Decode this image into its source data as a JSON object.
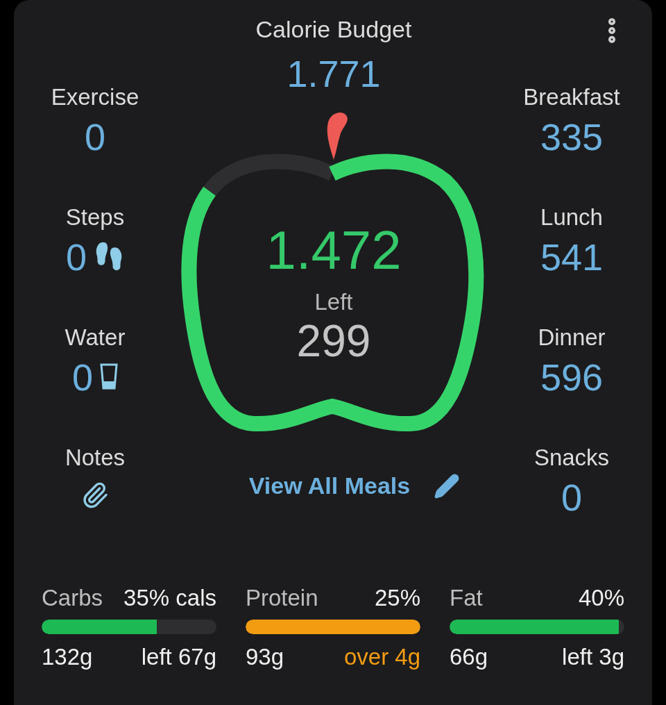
{
  "header": {
    "title": "Calorie Budget",
    "budget": "1.771"
  },
  "left_stats": [
    {
      "kind": "plain",
      "label": "Exercise",
      "value": "0"
    },
    {
      "kind": "steps",
      "label": "Steps",
      "value": "0"
    },
    {
      "kind": "water",
      "label": "Water",
      "value": "0"
    },
    {
      "kind": "notes",
      "label": "Notes"
    }
  ],
  "right_stats": [
    {
      "label": "Breakfast",
      "value": "335"
    },
    {
      "label": "Lunch",
      "value": "541"
    },
    {
      "label": "Dinner",
      "value": "596"
    },
    {
      "label": "Snacks",
      "value": "0"
    }
  ],
  "ring": {
    "consumed": "1.472",
    "caption": "Left",
    "remaining": "299"
  },
  "view_all": {
    "label": "View All Meals"
  },
  "macros": [
    {
      "name": "Carbs",
      "share": "35% cals",
      "level": 0.66,
      "color": "#1db954",
      "amount": "132g",
      "balance": "left 67g",
      "over": false
    },
    {
      "name": "Protein",
      "share": "25%",
      "level": 1,
      "color": "#f39c12",
      "amount": "93g",
      "balance": "over 4g",
      "over": true
    },
    {
      "name": "Fat",
      "share": "40%",
      "level": 0.97,
      "color": "#1db954",
      "amount": "66g",
      "balance": "left 3g",
      "over": false
    }
  ]
}
